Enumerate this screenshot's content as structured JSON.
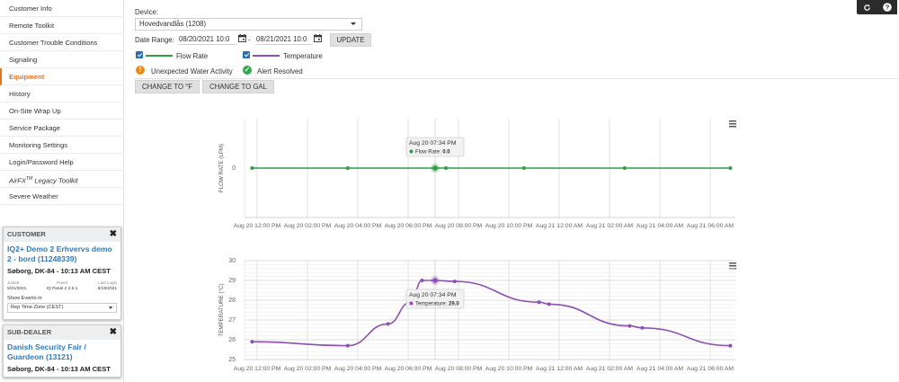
{
  "sidebar": {
    "items": [
      {
        "label": "Customer Info",
        "active": false
      },
      {
        "label": "Remote Toolkit",
        "active": false
      },
      {
        "label": "Customer Trouble Conditions",
        "active": false
      },
      {
        "label": "Signaling",
        "active": false
      },
      {
        "label": "Equipment",
        "active": true
      },
      {
        "label": "History",
        "active": false
      },
      {
        "label": "On-Site Wrap Up",
        "active": false
      },
      {
        "label": "Service Package",
        "active": false
      },
      {
        "label": "Monitoring Settings",
        "active": false
      },
      {
        "label": "Login/Password Help",
        "active": false
      }
    ],
    "legacy": {
      "prefix": "AirFX",
      "sup": "TM",
      "suffix": " Legacy Toolkit"
    },
    "last_item": "Severe Weather"
  },
  "customer_card": {
    "heading": "CUSTOMER",
    "name": "IQ2+ Demo 2 Erhvervs demo 2 - bord (11248339)",
    "location": "Søborg, DK-84 - 10:13 AM CEST",
    "meta": [
      {
        "label": "Joined",
        "value": "5/21/2021"
      },
      {
        "label": "Panel",
        "value": "IQ Panel 2 2.6.1"
      },
      {
        "label": "Last Login",
        "value": "8/19/2021"
      }
    ],
    "events_label": "Show Events in",
    "timezone": "Rep Time Zone (CEST)"
  },
  "dealer_card": {
    "heading": "SUB-DEALER",
    "name": "Danish Security Fair / Guardeon (13121)",
    "location": "Søborg, DK-84 - 10:13 AM CEST"
  },
  "filters": {
    "device_label": "Device:",
    "device_value": "Hovedvandlås (1208)",
    "date_range_label": "Date Range:",
    "date_from": "08/20/2021 10:0",
    "date_separator": "-",
    "date_to": "08/21/2021 10:0",
    "update_button": "UPDATE"
  },
  "legend": {
    "flow_rate": {
      "label": "Flow Rate",
      "color": "#2e9e44"
    },
    "temperature": {
      "label": "Temperature",
      "color": "#8f4eb1"
    }
  },
  "statuses": {
    "warning": {
      "label": "Unexpected Water Activity",
      "color": "#ef8a17"
    },
    "resolved": {
      "label": "Alert Resolved",
      "color": "#2fa84f"
    }
  },
  "buttons": {
    "change_temp": "CHANGE TO °F",
    "change_flow": "CHANGE TO GAL"
  },
  "chart_data": [
    {
      "type": "line",
      "ylabel": "FLOW RATE (LPM)",
      "xlabel": "",
      "x_ticks": [
        "Aug 20 12:00 PM",
        "Aug 20 02:00 PM",
        "Aug 20 04:00 PM",
        "Aug 20 06:00 PM",
        "Aug 20 08:00 PM",
        "Aug 20 10:00 PM",
        "Aug 21 12:00 AM",
        "Aug 21 02:00 AM",
        "Aug 21 04:00 AM",
        "Aug 21 06:00 AM"
      ],
      "y_ticks": [
        "0"
      ],
      "xlim_hours": [
        0,
        19.5
      ],
      "ylim": [
        -1,
        1
      ],
      "series": [
        {
          "name": "Flow Rate",
          "color": "#2e9e44",
          "x": [
            0.3,
            4.1,
            7.57,
            8.0,
            11.1,
            15.1,
            19.3
          ],
          "y": [
            0,
            0,
            0,
            0,
            0,
            0,
            0
          ]
        }
      ],
      "tooltip": {
        "title": "Aug 20 07:34 PM",
        "label": "Flow Rate:",
        "value": "0.0",
        "x": 7.57,
        "y": 0
      }
    },
    {
      "type": "line",
      "ylabel": "TEMPERATURE (°C)",
      "xlabel": "",
      "x_ticks": [
        "Aug 20 12:00 PM",
        "Aug 20 02:00 PM",
        "Aug 20 04:00 PM",
        "Aug 20 06:00 PM",
        "Aug 20 08:00 PM",
        "Aug 20 10:00 PM",
        "Aug 21 12:00 AM",
        "Aug 21 02:00 AM",
        "Aug 21 04:00 AM",
        "Aug 21 06:00 AM"
      ],
      "y_ticks": [
        "25",
        "26",
        "27",
        "28",
        "29",
        "30"
      ],
      "xlim_hours": [
        0,
        19.5
      ],
      "ylim": [
        25,
        30
      ],
      "series": [
        {
          "name": "Temperature",
          "color": "#8f4eb1",
          "x": [
            0.3,
            4.1,
            5.7,
            6.6,
            7.05,
            7.57,
            8.35,
            11.7,
            12.1,
            15.3,
            15.8,
            19.3
          ],
          "y": [
            25.9,
            25.7,
            26.8,
            27.9,
            29.0,
            29.0,
            28.95,
            27.9,
            27.8,
            26.7,
            26.6,
            25.7
          ]
        }
      ],
      "tooltip": {
        "title": "Aug 20 07:34 PM",
        "label": "Temperature:",
        "value": "29.0",
        "x": 7.57,
        "y": 29.0
      }
    }
  ]
}
